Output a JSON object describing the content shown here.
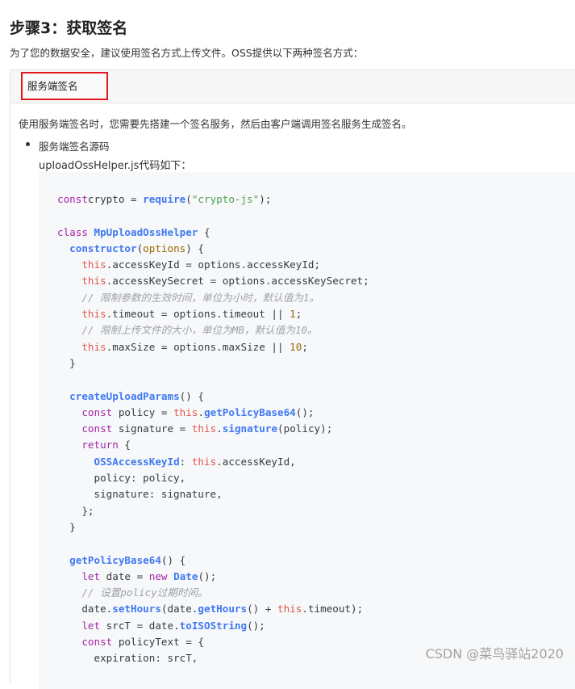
{
  "page": {
    "step_title": "步骤3：获取签名",
    "intro": "为了您的数据安全，建议使用签名方式上传文件。OSS提供以下两种签名方式："
  },
  "tabs": [
    {
      "label": "服务端签名",
      "active": true
    }
  ],
  "content": {
    "description": "使用服务端签名时，您需要先搭建一个签名服务，然后由客户端调用签名服务生成签名。",
    "bullet": "服务端签名源码",
    "code_caption": "uploadOssHelper.js代码如下："
  },
  "code_lines": [
    [
      [
        "k",
        "const"
      ],
      [
        "",
        "crypto = "
      ],
      [
        "n",
        "require"
      ],
      [
        "",
        "("
      ],
      [
        "s",
        "\"crypto-js\""
      ],
      [
        "",
        ");"
      ]
    ],
    [],
    [
      [
        "k",
        "class "
      ],
      [
        "n",
        "MpUploadOssHelper"
      ],
      [
        "",
        " {"
      ]
    ],
    [
      [
        "",
        "  "
      ],
      [
        "n",
        "constructor"
      ],
      [
        "",
        "("
      ],
      [
        "m",
        "options"
      ],
      [
        "",
        ") {"
      ]
    ],
    [
      [
        "",
        "    "
      ],
      [
        "t",
        "this"
      ],
      [
        "",
        ".accessKeyId = options.accessKeyId;"
      ]
    ],
    [
      [
        "",
        "    "
      ],
      [
        "t",
        "this"
      ],
      [
        "",
        ".accessKeySecret = options.accessKeySecret;"
      ]
    ],
    [
      [
        "",
        "    "
      ],
      [
        "c",
        "// 限制参数的生效时间，单位为小时，默认值为1。"
      ]
    ],
    [
      [
        "",
        "    "
      ],
      [
        "t",
        "this"
      ],
      [
        "",
        ".timeout = options.timeout || "
      ],
      [
        "m",
        "1"
      ],
      [
        "",
        ";"
      ]
    ],
    [
      [
        "",
        "    "
      ],
      [
        "c",
        "// 限制上传文件的大小，单位为MB，默认值为10。"
      ]
    ],
    [
      [
        "",
        "    "
      ],
      [
        "t",
        "this"
      ],
      [
        "",
        ".maxSize = options.maxSize || "
      ],
      [
        "m",
        "10"
      ],
      [
        "",
        ";"
      ]
    ],
    [
      [
        "",
        "  }"
      ]
    ],
    [],
    [
      [
        "",
        "  "
      ],
      [
        "n",
        "createUploadParams"
      ],
      [
        "",
        "() {"
      ]
    ],
    [
      [
        "",
        "    "
      ],
      [
        "k",
        "const"
      ],
      [
        "",
        " policy = "
      ],
      [
        "t",
        "this"
      ],
      [
        "",
        "."
      ],
      [
        "n",
        "getPolicyBase64"
      ],
      [
        "",
        "();"
      ]
    ],
    [
      [
        "",
        "    "
      ],
      [
        "k",
        "const"
      ],
      [
        "",
        " signature = "
      ],
      [
        "t",
        "this"
      ],
      [
        "",
        "."
      ],
      [
        "n",
        "signature"
      ],
      [
        "",
        "(policy);"
      ]
    ],
    [
      [
        "",
        "    "
      ],
      [
        "k",
        "return"
      ],
      [
        "",
        " {"
      ]
    ],
    [
      [
        "",
        "      "
      ],
      [
        "n",
        "OSSAccessKeyId"
      ],
      [
        "",
        ": "
      ],
      [
        "t",
        "this"
      ],
      [
        "",
        ".accessKeyId,"
      ]
    ],
    [
      [
        "",
        "      policy: policy,"
      ]
    ],
    [
      [
        "",
        "      signature: signature,"
      ]
    ],
    [
      [
        "",
        "    };"
      ]
    ],
    [
      [
        "",
        "  }"
      ]
    ],
    [],
    [
      [
        "",
        "  "
      ],
      [
        "n",
        "getPolicyBase64"
      ],
      [
        "",
        "() {"
      ]
    ],
    [
      [
        "",
        "    "
      ],
      [
        "k",
        "let"
      ],
      [
        "",
        " date = "
      ],
      [
        "k",
        "new "
      ],
      [
        "n",
        "Date"
      ],
      [
        "",
        "();"
      ]
    ],
    [
      [
        "",
        "    "
      ],
      [
        "c",
        "// 设置policy过期时间。"
      ]
    ],
    [
      [
        "",
        "    date."
      ],
      [
        "n",
        "setHours"
      ],
      [
        "",
        "(date."
      ],
      [
        "n",
        "getHours"
      ],
      [
        "",
        "() + "
      ],
      [
        "t",
        "this"
      ],
      [
        "",
        ".timeout);"
      ]
    ],
    [
      [
        "",
        "    "
      ],
      [
        "k",
        "let"
      ],
      [
        "",
        " srcT = date."
      ],
      [
        "n",
        "toISOString"
      ],
      [
        "",
        "();"
      ]
    ],
    [
      [
        "",
        "    "
      ],
      [
        "k",
        "const"
      ],
      [
        "",
        " policyText = {"
      ]
    ],
    [
      [
        "",
        "      expiration: srcT,"
      ]
    ]
  ],
  "watermark": "CSDN @菜鸟驿站2020"
}
